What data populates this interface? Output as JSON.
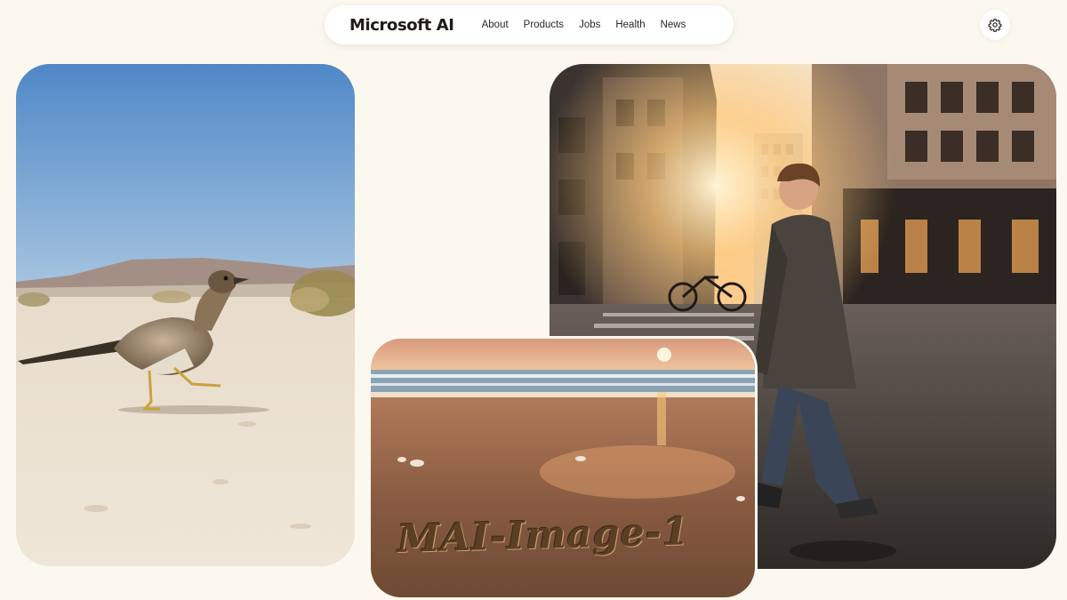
{
  "header": {
    "brand": "Microsoft AI",
    "nav_items": [
      {
        "label": "About"
      },
      {
        "label": "Products"
      },
      {
        "label": "Jobs"
      },
      {
        "label": "Health"
      },
      {
        "label": "News"
      }
    ],
    "settings_icon": "gear-icon"
  },
  "gallery": {
    "beach_caption": "MAI-Image-1"
  },
  "colors": {
    "background": "#fbf8ef",
    "nav_surface": "#ffffff",
    "text": "#1f1c18"
  }
}
